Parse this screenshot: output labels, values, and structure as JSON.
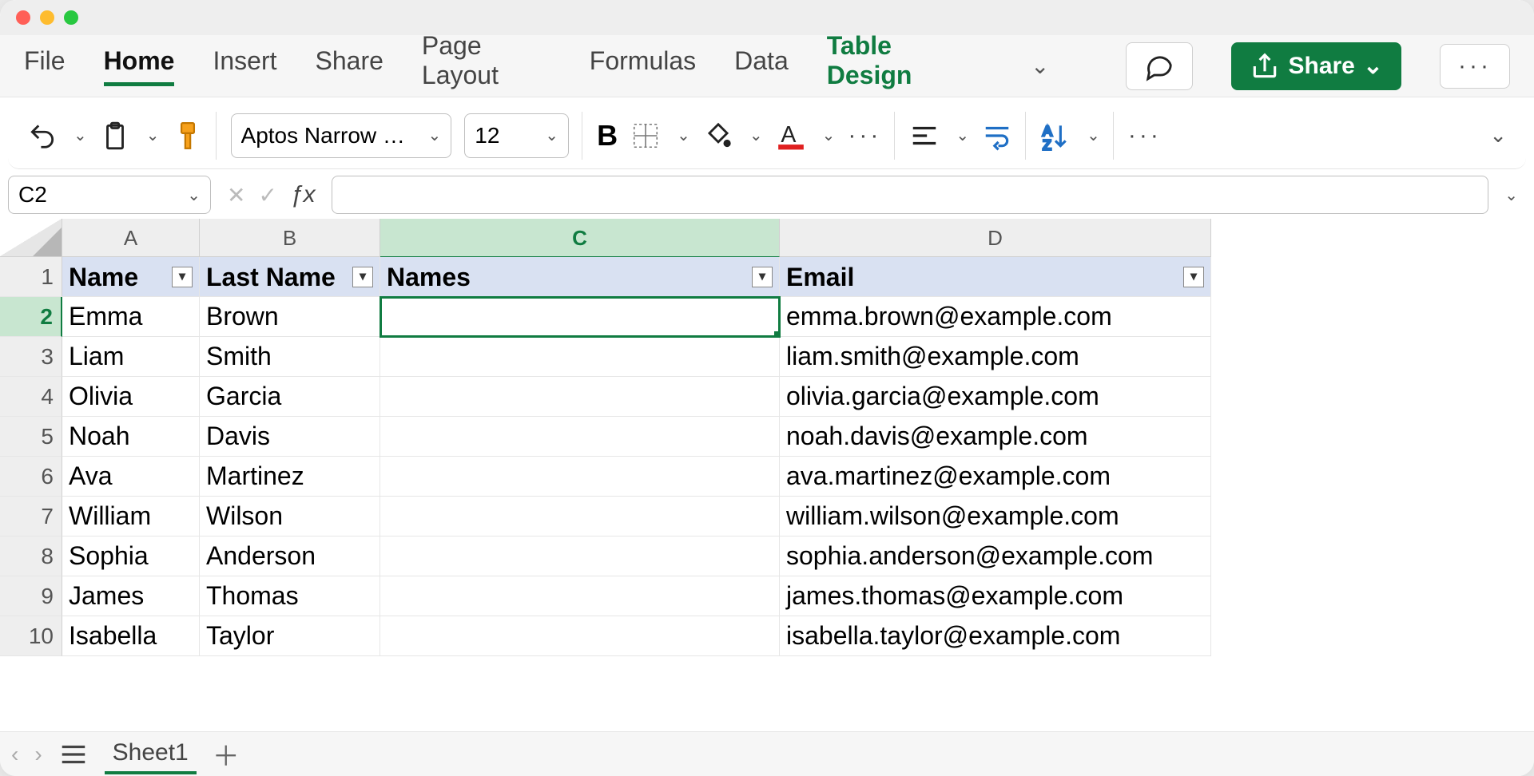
{
  "tabs": {
    "file": "File",
    "home": "Home",
    "insert": "Insert",
    "share_tab": "Share",
    "page_layout": "Page Layout",
    "formulas": "Formulas",
    "data": "Data",
    "table_design": "Table Design"
  },
  "ribbon": {
    "font_name": "Aptos Narrow …",
    "font_size": "12",
    "bold": "B"
  },
  "top_buttons": {
    "share": "Share"
  },
  "namebox": "C2",
  "formula": "",
  "columns": [
    "A",
    "B",
    "C",
    "D"
  ],
  "headers": [
    "Name",
    "Last Name",
    "Names",
    "Email"
  ],
  "rows": [
    {
      "n": "1"
    },
    {
      "n": "2",
      "a": "Emma",
      "b": "Brown",
      "c": "",
      "d": "emma.brown@example.com"
    },
    {
      "n": "3",
      "a": "Liam",
      "b": "Smith",
      "c": "",
      "d": "liam.smith@example.com"
    },
    {
      "n": "4",
      "a": "Olivia",
      "b": "Garcia",
      "c": "",
      "d": "olivia.garcia@example.com"
    },
    {
      "n": "5",
      "a": "Noah",
      "b": "Davis",
      "c": "",
      "d": "noah.davis@example.com"
    },
    {
      "n": "6",
      "a": "Ava",
      "b": "Martinez",
      "c": "",
      "d": "ava.martinez@example.com"
    },
    {
      "n": "7",
      "a": "William",
      "b": "Wilson",
      "c": "",
      "d": "william.wilson@example.com"
    },
    {
      "n": "8",
      "a": "Sophia",
      "b": "Anderson",
      "c": "",
      "d": "sophia.anderson@example.com"
    },
    {
      "n": "9",
      "a": "James",
      "b": "Thomas",
      "c": "",
      "d": "james.thomas@example.com"
    },
    {
      "n": "10",
      "a": "Isabella",
      "b": "Taylor",
      "c": "",
      "d": "isabella.taylor@example.com"
    }
  ],
  "sheet": "Sheet1",
  "selected": {
    "col": "C",
    "row": 2
  }
}
